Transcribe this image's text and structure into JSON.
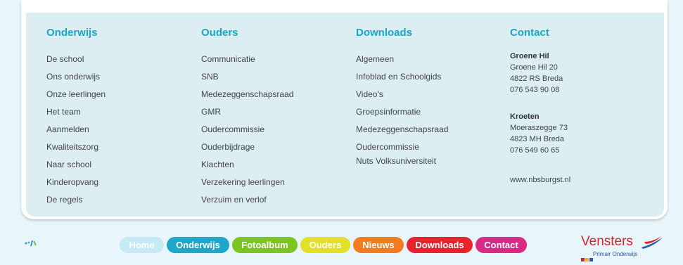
{
  "footer": {
    "columns": [
      {
        "title": "Onderwijs",
        "items": [
          "De school",
          "Ons onderwijs",
          "Onze leerlingen",
          "Het team",
          "Aanmelden",
          "Kwaliteitszorg",
          "Naar school",
          "Kinderopvang",
          "De regels"
        ]
      },
      {
        "title": "Ouders",
        "items": [
          "Communicatie",
          "SNB",
          "Medezeggenschapsraad",
          "GMR",
          "Oudercommissie",
          "Ouderbijdrage",
          "Klachten",
          "Verzekering leerlingen",
          "Verzuim en verlof"
        ]
      },
      {
        "title": "Downloads",
        "items": [
          "Algemeen",
          "Infoblad en Schoolgids",
          "Video's",
          "Groepsinformatie",
          "Medezeggenschapsraad",
          "Oudercommissie",
          "Nuts Volksuniversiteit"
        ]
      }
    ],
    "contact": {
      "title": "Contact",
      "loc1": {
        "name": "Groene Hil",
        "street": "Groene Hil 20",
        "city": "4822 RS Breda",
        "phone": "076 543 90 08"
      },
      "loc2": {
        "name": "Kroeten",
        "street": "Moeraszegge 73",
        "city": "4823 MH Breda",
        "phone": "076 549 60 65"
      },
      "website": "www.nbsburgst.nl"
    }
  },
  "bottom_nav": [
    {
      "label": "Home",
      "color": "#c5e9f5"
    },
    {
      "label": "Onderwijs",
      "color": "#1ea7c9"
    },
    {
      "label": "Fotoalbum",
      "color": "#7cc520"
    },
    {
      "label": "Ouders",
      "color": "#e2e128"
    },
    {
      "label": "Nieuws",
      "color": "#f47c20"
    },
    {
      "label": "Downloads",
      "color": "#e8232d"
    },
    {
      "label": "Contact",
      "color": "#d92a86"
    }
  ],
  "logo": {
    "name": "Vensters",
    "subtitle": "Primair Onderwijs"
  },
  "icons": {
    "leaf": "leaf-icon",
    "swoosh": "swoosh-icon"
  }
}
